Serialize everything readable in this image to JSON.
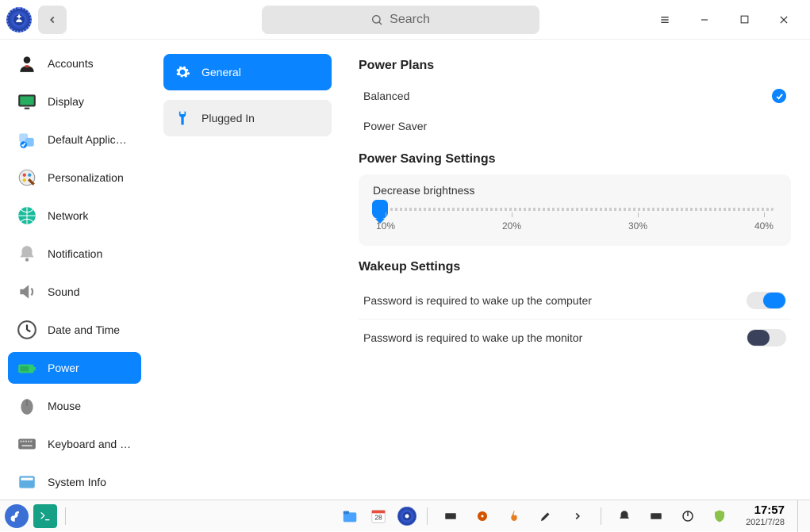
{
  "titlebar": {
    "search_placeholder": "Search"
  },
  "sidebar": {
    "items": [
      {
        "label": "Accounts",
        "icon": "accounts"
      },
      {
        "label": "Display",
        "icon": "display"
      },
      {
        "label": "Default Applic…",
        "icon": "default-apps"
      },
      {
        "label": "Personalization",
        "icon": "personalization"
      },
      {
        "label": "Network",
        "icon": "network"
      },
      {
        "label": "Notification",
        "icon": "notification"
      },
      {
        "label": "Sound",
        "icon": "sound"
      },
      {
        "label": "Date and Time",
        "icon": "datetime"
      },
      {
        "label": "Power",
        "icon": "power",
        "active": true
      },
      {
        "label": "Mouse",
        "icon": "mouse"
      },
      {
        "label": "Keyboard and …",
        "icon": "keyboard"
      },
      {
        "label": "System Info",
        "icon": "sysinfo"
      }
    ]
  },
  "middle": {
    "items": [
      {
        "label": "General",
        "icon": "gear",
        "active": true
      },
      {
        "label": "Plugged In",
        "icon": "plug",
        "active": false
      }
    ]
  },
  "content": {
    "plans_title": "Power Plans",
    "plans": [
      {
        "label": "Balanced",
        "selected": true
      },
      {
        "label": "Power Saver",
        "selected": false
      }
    ],
    "saving_title": "Power Saving Settings",
    "brightness_label": "Decrease brightness",
    "brightness_ticks": [
      "10%",
      "20%",
      "30%",
      "40%"
    ],
    "wakeup_title": "Wakeup Settings",
    "wakeup": [
      {
        "label": "Password is required to wake up the computer",
        "on": true
      },
      {
        "label": "Password is required to wake up the monitor",
        "on": false
      }
    ]
  },
  "taskbar": {
    "time": "17:57",
    "date": "2021/7/28",
    "calendar_day": "28"
  }
}
